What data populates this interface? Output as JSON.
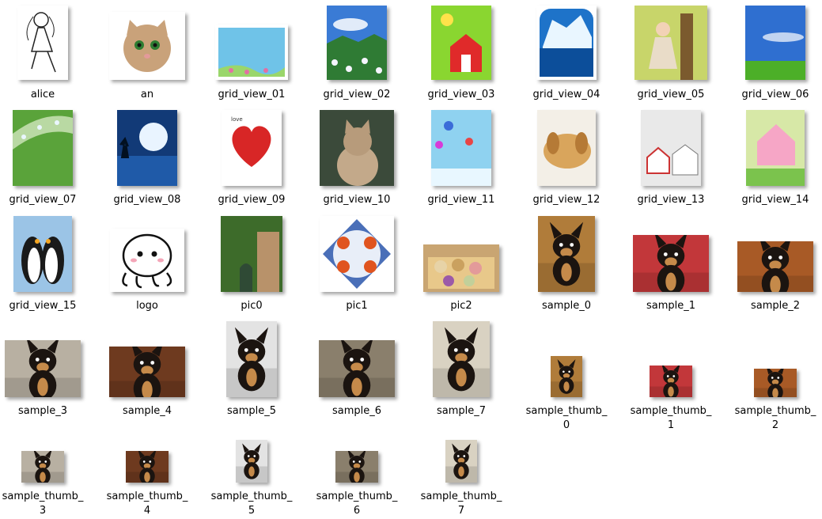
{
  "files": [
    {
      "label": "alice",
      "icon": "girl-drawing-icon",
      "color": "#ffffff"
    },
    {
      "label": "an",
      "icon": "cat-face-icon",
      "color": "#c9a27a"
    },
    {
      "label": "grid_view_01",
      "icon": "blue-card-icon",
      "color": "#6fc3e8"
    },
    {
      "label": "grid_view_02",
      "icon": "meadow-flowers-icon",
      "color": "#3a7bd5"
    },
    {
      "label": "grid_view_03",
      "icon": "green-house-icon",
      "color": "#8ad630"
    },
    {
      "label": "grid_view_04",
      "icon": "iceberg-icon",
      "color": "#1e73c9"
    },
    {
      "label": "grid_view_05",
      "icon": "girl-tree-icon",
      "color": "#c8d56a"
    },
    {
      "label": "grid_view_06",
      "icon": "blue-sky-grass-icon",
      "color": "#2f6fd0"
    },
    {
      "label": "grid_view_07",
      "icon": "leaf-droplets-icon",
      "color": "#5aa33a"
    },
    {
      "label": "grid_view_08",
      "icon": "night-moon-icon",
      "color": "#123a77"
    },
    {
      "label": "grid_view_09",
      "icon": "heart-card-icon",
      "color": "#f1d7d7"
    },
    {
      "label": "grid_view_10",
      "icon": "kitten-icon",
      "color": "#7b6c58"
    },
    {
      "label": "grid_view_11",
      "icon": "balloons-icon",
      "color": "#8fd2f0"
    },
    {
      "label": "grid_view_12",
      "icon": "puppy-icon",
      "color": "#d9a55c"
    },
    {
      "label": "grid_view_13",
      "icon": "cartoon-houses-icon",
      "color": "#e9e9e9"
    },
    {
      "label": "grid_view_14",
      "icon": "pink-house-icon",
      "color": "#d7e8a7"
    },
    {
      "label": "grid_view_15",
      "icon": "penguins-icon",
      "color": "#9bc4e6"
    },
    {
      "label": "logo",
      "icon": "octopus-logo-icon",
      "color": "#ffffff"
    },
    {
      "label": "pic0",
      "icon": "ivy-building-icon",
      "color": "#5d6b3a"
    },
    {
      "label": "pic1",
      "icon": "crabs-plate-icon",
      "color": "#f3f3f3"
    },
    {
      "label": "pic2",
      "icon": "pastries-icon",
      "color": "#c9a572"
    },
    {
      "label": "sample_0",
      "icon": "chihuahua-icon",
      "color": "#b07c3a"
    },
    {
      "label": "sample_1",
      "icon": "chihuahua-icon",
      "color": "#c2373a"
    },
    {
      "label": "sample_2",
      "icon": "chihuahua-icon",
      "color": "#a85a26"
    },
    {
      "label": "sample_3",
      "icon": "chihuahua-icon",
      "color": "#b8b0a2"
    },
    {
      "label": "sample_4",
      "icon": "chihuahua-icon",
      "color": "#6e3a1f"
    },
    {
      "label": "sample_5",
      "icon": "chihuahua-icon",
      "color": "#e3e3e3"
    },
    {
      "label": "sample_6",
      "icon": "chihuahua-icon",
      "color": "#8a7f6c"
    },
    {
      "label": "sample_7",
      "icon": "chihuahua-icon",
      "color": "#d9d2c2"
    },
    {
      "label": "sample_thumb_\n0",
      "icon": "chihuahua-icon",
      "color": "#b07c3a"
    },
    {
      "label": "sample_thumb_\n1",
      "icon": "chihuahua-icon",
      "color": "#c2373a"
    },
    {
      "label": "sample_thumb_\n2",
      "icon": "chihuahua-icon",
      "color": "#a85a26"
    },
    {
      "label": "sample_thumb_\n3",
      "icon": "chihuahua-icon",
      "color": "#b8b0a2"
    },
    {
      "label": "sample_thumb_\n4",
      "icon": "chihuahua-icon",
      "color": "#6e3a1f"
    },
    {
      "label": "sample_thumb_\n5",
      "icon": "chihuahua-icon",
      "color": "#e3e3e3"
    },
    {
      "label": "sample_thumb_\n6",
      "icon": "chihuahua-icon",
      "color": "#8a7f6c"
    },
    {
      "label": "sample_thumb_\n7",
      "icon": "chihuahua-icon",
      "color": "#d9d2c2"
    }
  ]
}
